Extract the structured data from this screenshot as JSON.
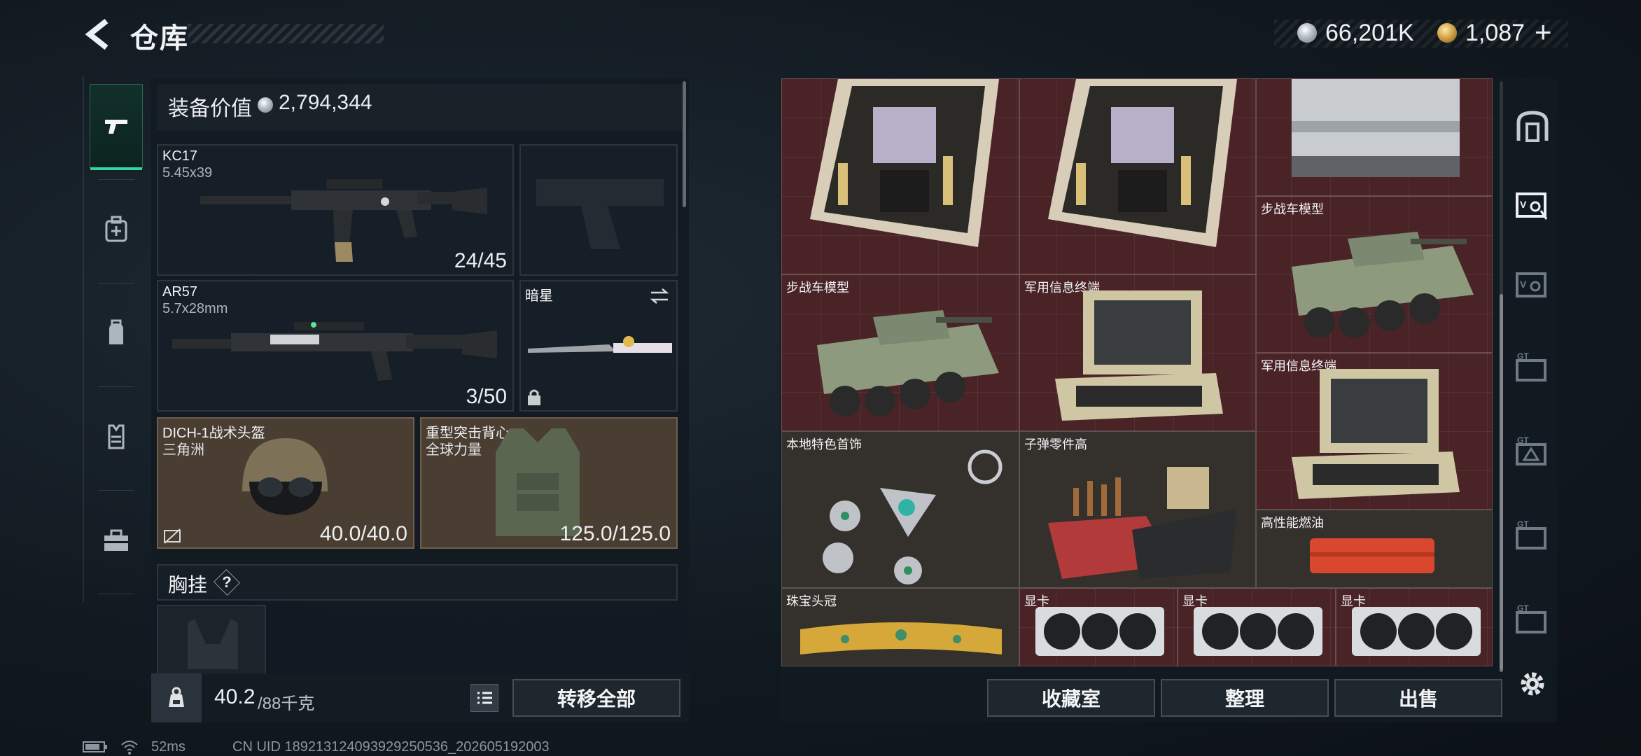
{
  "header": {
    "title": "仓库",
    "currency_silver": "66,201K",
    "currency_gold": "1,087",
    "add_symbol": "+"
  },
  "equipment": {
    "value_label": "装备价值",
    "value_amount": "2,794,344",
    "primary_weapon": {
      "name": "KC17",
      "caliber": "5.45x39",
      "ammo": "24/45"
    },
    "secondary_weapon": {
      "name": "AR57",
      "caliber": "5.7x28mm",
      "ammo": "3/50"
    },
    "melee": {
      "name": "暗星"
    },
    "helmet": {
      "name": "DICH-1战术头盔",
      "origin": "三角洲",
      "durability": "40.0/40.0"
    },
    "armor": {
      "name": "重型突击背心",
      "origin": "全球力量",
      "durability": "125.0/125.0"
    },
    "chest_rig_label": "胸挂",
    "chest_rig_help": "?"
  },
  "footer_left": {
    "weight_value": "40.2",
    "weight_max": "/88千克",
    "transfer_all_label": "转移全部"
  },
  "storage": {
    "items": [
      {
        "label": "步战车模型"
      },
      {
        "label": "步战车模型"
      },
      {
        "label": "军用信息终端"
      },
      {
        "label": "军用信息终端"
      },
      {
        "label": "本地特色首饰"
      },
      {
        "label": "子弹零件高"
      },
      {
        "label": "高性能燃油"
      },
      {
        "label": "珠宝头冠"
      },
      {
        "label": "显卡"
      },
      {
        "label": "显卡"
      },
      {
        "label": "显卡"
      }
    ]
  },
  "footer_right": {
    "collection_label": "收藏室",
    "organize_label": "整理",
    "sell_label": "出售"
  },
  "status": {
    "ping": "52ms",
    "uid": "CN UID 189213124093929250536_202605192003"
  },
  "colors": {
    "accent_green": "#38d3a2",
    "grid_red": "#4a2327",
    "panel_dark": "#121a22"
  }
}
